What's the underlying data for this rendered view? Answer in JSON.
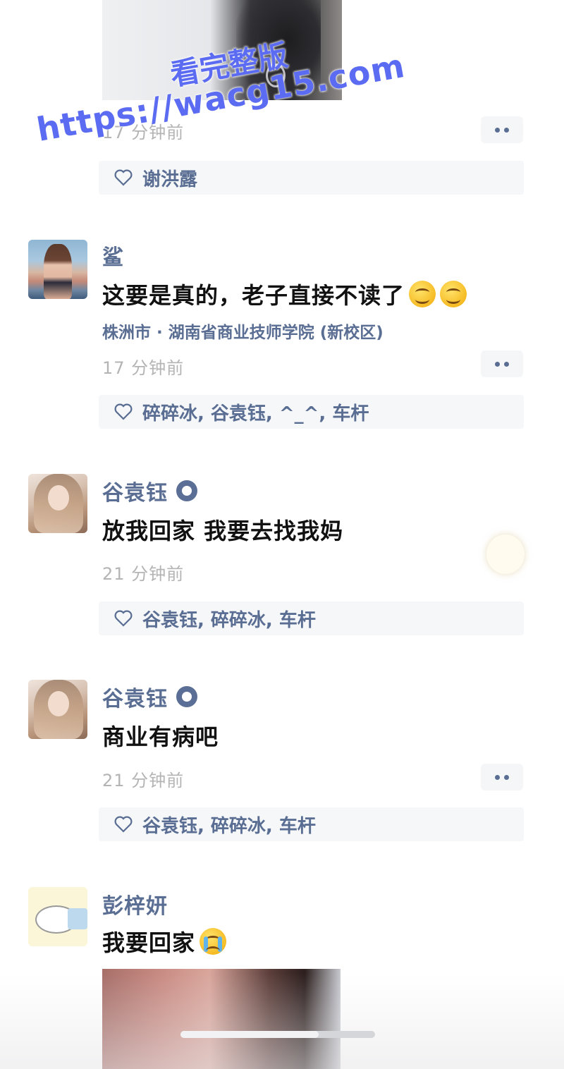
{
  "watermark": {
    "url": "https://wacg15.com",
    "subtitle": "看完整版"
  },
  "top_post": {
    "time": "17 分钟前",
    "likes": "谢洪露"
  },
  "comments": [
    {
      "name": "鲨",
      "content": "这要是真的，老子直接不读了",
      "emoji": [
        "smile-emoji",
        "smile-emoji"
      ],
      "location": "株洲市 · 湖南省商业技师学院 (新校区)",
      "time": "17 分钟前",
      "likes": "碎碎冰, 谷袁钰, ^_^, 车杆"
    },
    {
      "name": "谷袁钰",
      "content": "放我回家 我要去找我妈",
      "time": "21 分钟前",
      "likes": "谷袁钰, 碎碎冰, 车杆"
    },
    {
      "name": "谷袁钰",
      "content": "商业有病吧",
      "time": "21 分钟前",
      "likes": "谷袁钰, 碎碎冰, 车杆"
    },
    {
      "name": "彭梓妍",
      "content": "我要回家",
      "emoji": [
        "crying-emoji"
      ]
    }
  ],
  "colors": {
    "name_blue": "#5a6e93",
    "like_bg": "#f6f7f9",
    "time_gray": "#b4b4b4",
    "watermark": "#5c6cf2"
  }
}
